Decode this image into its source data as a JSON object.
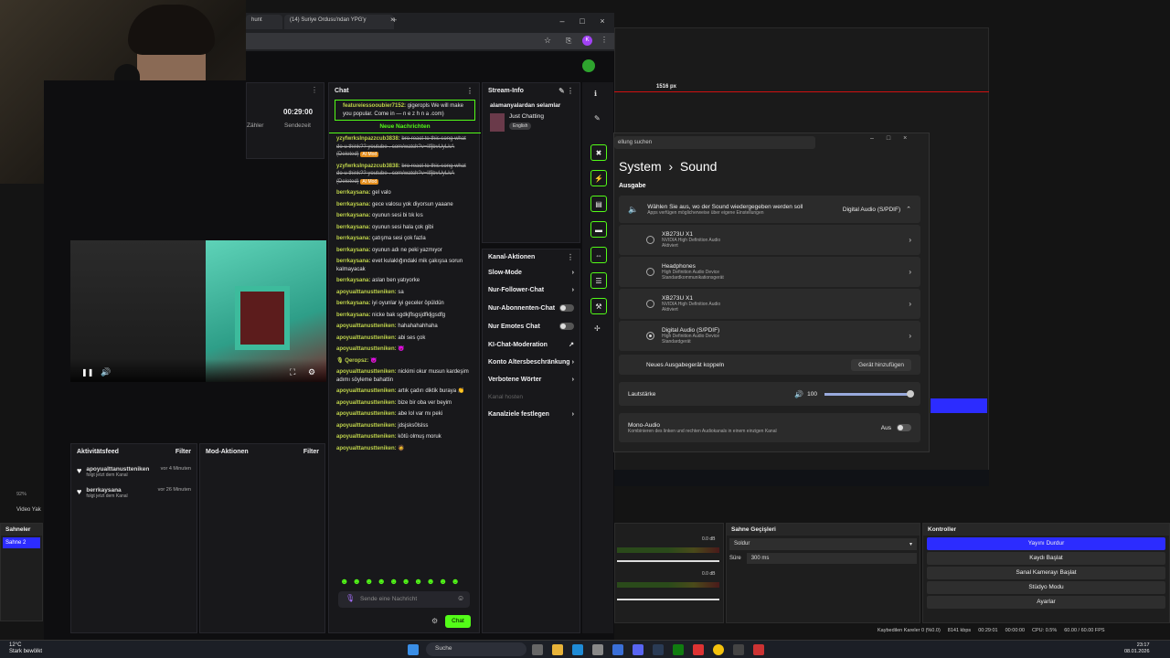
{
  "browser": {
    "tab1": "hunt",
    "tab2": "(14) Suriye Ordusu'ndan YPG'y",
    "avatar": "K"
  },
  "stats": {
    "time": "00:29:00",
    "label1": "Zähler",
    "label2": "Sendezeit"
  },
  "chat": {
    "title": "Chat",
    "first_msg_user": "featureiessooubier7152:",
    "first_msg_text": "gigeropls We will make you popular. Come in — n e z h n a .com)",
    "new_messages": "Neue Nachrichten",
    "messages": [
      {
        "user": "yzyfwrksInpazzcub3838:",
        "text": "bro react to this song what do u think?? youtube . com/watch?v=lIfjbvUyLkA (Deleted)",
        "deleted": true,
        "badge": "AI Mod"
      },
      {
        "user": "yzyfwrksInpazzcub3838:",
        "text": "bro react to this song what do u think?? youtube . com/watch?v=lIfjbvUyLkA (Deleted)",
        "deleted": true,
        "badge": "AI Mod"
      },
      {
        "user": "berrkaysana:",
        "text": "gel valo"
      },
      {
        "user": "berrkaysana:",
        "text": "gece valosu yok diyorsun yaaane"
      },
      {
        "user": "berrkaysana:",
        "text": "oyunun sesi bi tık kıs"
      },
      {
        "user": "berrkaysana:",
        "text": "oyunun sesi hala çok gibi"
      },
      {
        "user": "berrkaysana:",
        "text": "çatışma sesi çok fazla"
      },
      {
        "user": "berrkaysana:",
        "text": "oyunun adı ne peki yazmıyor"
      },
      {
        "user": "berrkaysana:",
        "text": "evet kulaklığındaki mik çakışsa sorun kalmayacak"
      },
      {
        "user": "berrkaysana:",
        "text": "aslan ben yatıyorke"
      },
      {
        "user": "apoyualttanustteniken:",
        "text": "sa"
      },
      {
        "user": "berrkaysana:",
        "text": "iyi oyunlar iyi geceler öpüldün"
      },
      {
        "user": "berrkaysana:",
        "text": "nicke bak sgdkjflsgsjdfkljgsdfg"
      },
      {
        "user": "apoyualttanustteniken:",
        "text": "hahahahahhaha"
      },
      {
        "user": "apoyualttanustteniken:",
        "text": "abi ses çok"
      },
      {
        "user": "apoyualttanustteniken:",
        "text": "😈"
      },
      {
        "user": "🎙 Qeropsz:",
        "text": "😈"
      },
      {
        "user": "apoyualttanustteniken:",
        "text": "nickimi okur musun kardeşim adımı söyleme bahattin"
      },
      {
        "user": "apoyualttanustteniken:",
        "text": "artık çadırı diktik buraya 👏"
      },
      {
        "user": "apoyualttanustteniken:",
        "text": "bize bir oba ver beyim"
      },
      {
        "user": "apoyualttanustteniken:",
        "text": "abe lol var mı peki"
      },
      {
        "user": "apoyualttanustteniken:",
        "text": "jdsjsks0lslss"
      },
      {
        "user": "apoyualttanustteniken:",
        "text": "kötü olmuş moruk"
      },
      {
        "user": "apoyualttanustteniken:",
        "text": "🧔"
      }
    ],
    "input_placeholder": "Sende eine Nachricht",
    "send_label": "Chat"
  },
  "stream_info": {
    "title": "Stream-Info",
    "stream_title": "alamanyalardan selamlar",
    "category": "Just Chatting",
    "language": "English"
  },
  "channel_actions": {
    "title": "Kanal-Aktionen",
    "items": [
      {
        "label": "Slow-Mode",
        "kind": "arrow"
      },
      {
        "label": "Nur-Follower-Chat",
        "kind": "arrow"
      },
      {
        "label": "Nur-Abonnenten-Chat",
        "kind": "toggle"
      },
      {
        "label": "Nur Emotes Chat",
        "kind": "toggle"
      },
      {
        "label": "KI-Chat-Moderation",
        "kind": "link"
      },
      {
        "label": "Konto Altersbeschränkung",
        "kind": "arrow"
      },
      {
        "label": "Verbotene Wörter",
        "kind": "arrow"
      }
    ],
    "hosting": "Kanal hosten",
    "goals": "Kanalziele festlegen"
  },
  "activity": {
    "title": "Aktivitätsfeed",
    "filter": "Filter",
    "items": [
      {
        "name": "apoyualttanustteniken",
        "sub": "folgt jetzt dem Kanal",
        "time": "vor 4 Minuten"
      },
      {
        "name": "berrkaysana",
        "sub": "folgt jetzt dem Kanal",
        "time": "vor 26 Minuten"
      }
    ]
  },
  "mod": {
    "title": "Mod-Aktionen",
    "filter": "Filter"
  },
  "settings": {
    "search": "ellung suchen",
    "crumb_parent": "System",
    "crumb_child": "Sound",
    "section": "Ausgabe",
    "output_title": "Wählen Sie aus, wo der Sound wiedergegeben werden soll",
    "output_sub": "Apps verfügen möglicherweise über eigene Einstellungen",
    "output_value": "Digital Audio (S/PDIF)",
    "devices": [
      {
        "name": "XB273U X1",
        "l1": "NVIDIA High Definition Audio",
        "l2": "Aktiviert",
        "selected": false
      },
      {
        "name": "Headphones",
        "l1": "High Definition Audio Device",
        "l2": "Standardkommunikationsgerät",
        "selected": false
      },
      {
        "name": "XB273U X1",
        "l1": "NVIDIA High Definition Audio",
        "l2": "Aktiviert",
        "selected": false
      },
      {
        "name": "Digital Audio (S/PDIF)",
        "l1": "High Definition Audio Device",
        "l2": "Standardgerät",
        "selected": true
      }
    ],
    "pair_label": "Neues Ausgabegerät koppeln",
    "add_device": "Gerät hinzufügen",
    "volume_label": "Lautstärke",
    "volume_value": "100",
    "mono_title": "Mono-Audio",
    "mono_sub": "Kombinieren des linken und rechten Audiokanals in einem einzigen Kanal",
    "mono_state": "Aus"
  },
  "obs": {
    "ruler": "1516 px",
    "ruler2": "1516 px",
    "zoom": "92%",
    "video_label": "Video Yak",
    "scenes_title": "Sahneler",
    "scene_item": "Sahne 2",
    "transitions_title": "Sahne Geçişleri",
    "transition": "Soldur",
    "duration_label": "Süre",
    "duration": "300 ms",
    "db1": "0.0 dB",
    "db2": "0.0 dB",
    "controls_title": "Kontroller",
    "controls": [
      "Yayını Durdur",
      "Kaydı Başlat",
      "Sanal Kamerayı Başlat",
      "Stüdyo Modu",
      "Ayarlar"
    ],
    "status_dropped": "Kaybedilen Kareler 0 (%0.0)",
    "status_kbps": "8141 kbps",
    "status_time": "00:29:01",
    "status_rec": "00:00:00",
    "status_cpu": "CPU: 0.5%",
    "status_fps": "60.00 / 60.00 FPS"
  },
  "taskbar": {
    "temp": "12°C",
    "weather": "Stark bewölkt",
    "search": "Suche",
    "time": "23:17",
    "date": "08.01.2026"
  },
  "accent": "#53fc18",
  "obs_blue": "#2c2cff"
}
